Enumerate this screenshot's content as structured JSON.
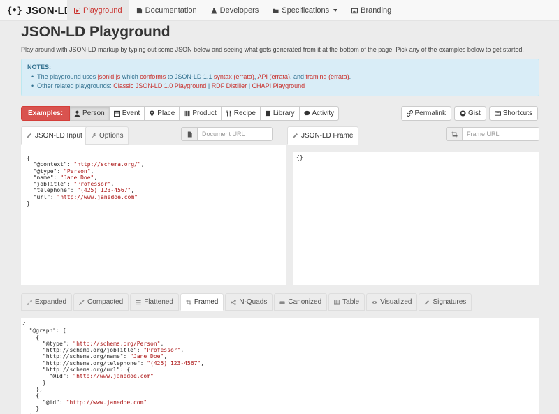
{
  "navbar": {
    "logo": "{•}",
    "brand": "JSON-LD",
    "items": [
      {
        "label": "Playground",
        "icon": "play-icon",
        "active": true
      },
      {
        "label": "Documentation",
        "icon": "book-icon"
      },
      {
        "label": "Developers",
        "icon": "flask-icon"
      },
      {
        "label": "Specifications",
        "icon": "folder-icon",
        "dropdown": true
      },
      {
        "label": "Branding",
        "icon": "image-icon"
      }
    ]
  },
  "header": {
    "title": "JSON-LD Playground",
    "description": "Play around with JSON-LD markup by typing out some JSON below and seeing what gets generated from it at the bottom of the page. Pick any of the examples below to get started."
  },
  "notes": {
    "title": "NOTES:",
    "line1": {
      "prefix": "The playground uses",
      "link1": "jsonld.js",
      "mid1": "which",
      "link2": "conforms",
      "mid2": "to JSON-LD 1.1",
      "link3": "syntax",
      "link4": "(errata)",
      "link5": "API",
      "link6": "(errata)",
      "mid3": ", and",
      "link7": "framing",
      "link8": "(errata)"
    },
    "line2": {
      "prefix": "Other related playgrounds:",
      "link1": "Classic JSON-LD 1.0 Playground",
      "link2": "RDF Distiller",
      "link3": "CHAPI Playground",
      "sep": "|"
    }
  },
  "examples": {
    "label": "Examples:",
    "items": [
      "Person",
      "Event",
      "Place",
      "Product",
      "Recipe",
      "Library",
      "Activity"
    ],
    "active": "Person"
  },
  "actions": {
    "permalink": "Permalink",
    "gist": "Gist",
    "shortcuts": "Shortcuts"
  },
  "input_panel": {
    "tab_input": "JSON-LD Input",
    "tab_options": "Options",
    "document_url_placeholder": "Document URL",
    "code": {
      "open": "{",
      "close": "}",
      "lines": [
        {
          "key": "\"@context\"",
          "value": "\"http://schema.org/\"",
          "comma": ","
        },
        {
          "key": "\"@type\"",
          "value": "\"Person\"",
          "comma": ","
        },
        {
          "key": "\"name\"",
          "value": "\"Jane Doe\"",
          "comma": ","
        },
        {
          "key": "\"jobTitle\"",
          "value": "\"Professor\"",
          "comma": ","
        },
        {
          "key": "\"telephone\"",
          "value": "\"(425) 123-4567\"",
          "comma": ","
        },
        {
          "key": "\"url\"",
          "value": "\"http://www.janedoe.com\"",
          "comma": ""
        }
      ]
    }
  },
  "frame_panel": {
    "tab": "JSON-LD Frame",
    "frame_url_placeholder": "Frame URL",
    "code": "{}"
  },
  "output": {
    "tabs": [
      "Expanded",
      "Compacted",
      "Flattened",
      "Framed",
      "N-Quads",
      "Canonized",
      "Table",
      "Visualized",
      "Signatures"
    ],
    "active": "Framed",
    "code": {
      "graph_key": "\"@graph\"",
      "type_key": "\"@type\"",
      "type_val": "\"http://schema.org/Person\"",
      "job_key": "\"http://schema.org/jobTitle\"",
      "job_val": "\"Professor\"",
      "name_key": "\"http://schema.org/name\"",
      "name_val": "\"Jane Doe\"",
      "tel_key": "\"http://schema.org/telephone\"",
      "tel_val": "\"(425) 123-4567\"",
      "url_key": "\"http://schema.org/url\"",
      "id_key": "\"@id\"",
      "id_val": "\"http://www.janedoe.com\""
    }
  }
}
